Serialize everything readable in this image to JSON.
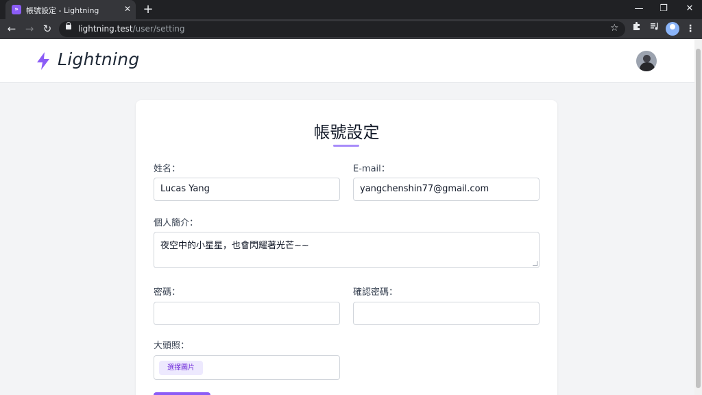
{
  "browser": {
    "tab_title": "帳號設定 - Lightning",
    "tab_favicon": "»",
    "tab_close": "✕",
    "new_tab": "+",
    "url_host": "lightning.test",
    "url_path": "/user/setting",
    "window_controls": {
      "minimize": "—",
      "restore": "❐",
      "close": "✕"
    },
    "nav": {
      "back": "←",
      "forward": "→",
      "reload": "↻"
    },
    "star": "☆",
    "menu": "⋮"
  },
  "site": {
    "logo_text": "Lightning",
    "accent_color": "#8b5cf6"
  },
  "form": {
    "title": "帳號設定",
    "name_label": "姓名：",
    "name_value": "Lucas Yang",
    "email_label": "E-mail：",
    "email_value": "yangchenshin77@gmail.com",
    "bio_label": "個人簡介：",
    "bio_value": "夜空中的小星星，也會閃耀著光芒~~",
    "password_label": "密碼：",
    "password_value": "",
    "confirm_password_label": "確認密碼：",
    "confirm_password_value": "",
    "avatar_label": "大頭照：",
    "choose_image_button": "選擇圖片"
  }
}
